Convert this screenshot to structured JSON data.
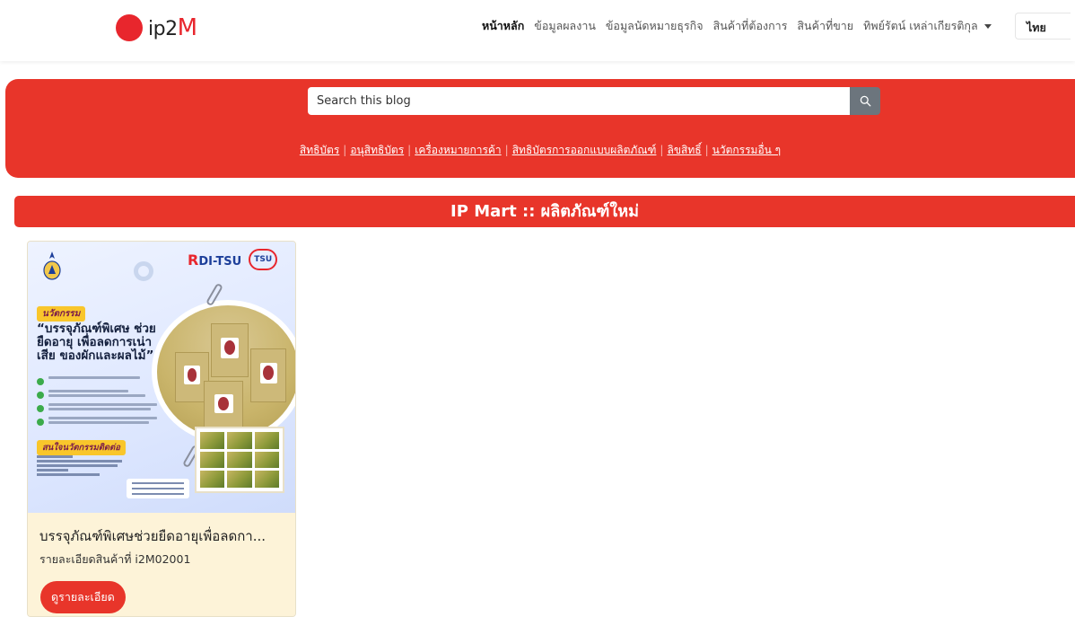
{
  "brand": {
    "logo_text": "ip2",
    "logo_suffix": "M"
  },
  "nav": {
    "items": [
      {
        "label": "หน้าหลัก",
        "active": true
      },
      {
        "label": "ข้อมูลผลงาน",
        "active": false
      },
      {
        "label": "ข้อมูลนัดหมายธุรกิจ",
        "active": false
      },
      {
        "label": "สินค้าที่ต้องการ",
        "active": false
      },
      {
        "label": "สินค้าที่ขาย",
        "active": false
      },
      {
        "label": "ทิพย์รัตน์ เหล่าเกียรติกุล",
        "active": false,
        "dropdown": true
      }
    ],
    "language": "ไทย"
  },
  "search": {
    "placeholder": "Search this blog",
    "icon": "search-icon"
  },
  "categories": [
    "สิทธิบัตร",
    "อนุสิทธิบัตร",
    "เครื่องหมายการค้า",
    "สิทธิบัตรการออกแบบผลิตภัณฑ์",
    "ลิขสิทธิ์",
    "นวัตกรรมอื่น ๆ"
  ],
  "section": {
    "title": "IP Mart :: ผลิตภัณฑ์ใหม่"
  },
  "product": {
    "title": "บรรจุภัณฑ์พิเศษช่วยยืดอายุเพื่อลดกา...",
    "code_text": "รายละเอียดสินค้าที่ i2M02001",
    "button_label": "ดูรายละเอียด",
    "poster": {
      "logo1": "DI-TSU",
      "logo2": "TSU",
      "tag": "นวัตกรรม",
      "headline": "“บรรจุภัณฑ์พิเศษ ช่วยยืดอายุ เพื่อลดการเน่าเสีย ของผักและผลไม้”",
      "contact_tag": "สนใจนวัตกรรมติดต่อ"
    }
  },
  "colors": {
    "brand_red": "#e8352a",
    "card_bg": "#fdf3d8",
    "search_btn": "#6c757d"
  }
}
